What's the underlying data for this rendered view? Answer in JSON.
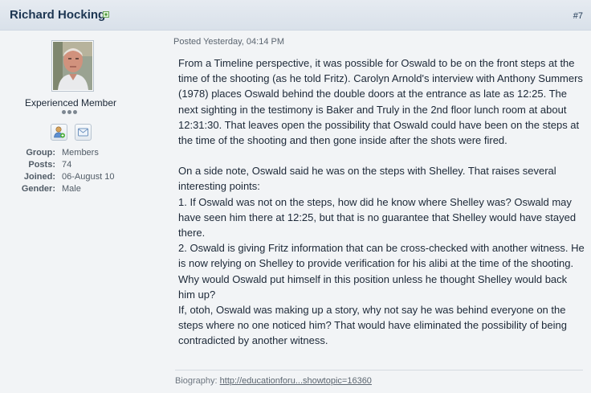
{
  "post": {
    "author": "Richard Hocking",
    "number": "#7",
    "posted": "Posted Yesterday, 04:14 PM"
  },
  "author_info": {
    "rank": "Experienced Member",
    "fields": [
      {
        "label": "Group:",
        "value": "Members"
      },
      {
        "label": "Posts:",
        "value": "74"
      },
      {
        "label": "Joined:",
        "value": "06-August 10"
      },
      {
        "label": "Gender:",
        "value": "Male"
      }
    ],
    "icons": [
      "profile-icon",
      "message-icon"
    ],
    "status_icon": "online-indicator-icon"
  },
  "body": {
    "para1": [
      "From a Timeline perspective, it was possible for Oswald to be on the front steps at the",
      "time of the shooting (as he told Fritz). Carolyn Arnold's interview with Anthony Summers",
      "(1978) places Oswald behind the double doors at the entrance as late as 12:25. The",
      "next sighting in the testimony is Baker and Truly in the 2nd floor lunch room at about",
      "12:31:30. That leaves open the possibility that Oswald could have been on the steps at",
      "the time of the shooting and then gone inside after the shots were fired."
    ],
    "para2": [
      "On a side note, Oswald said he was on the steps with Shelley. That raises several",
      "interesting points:",
      "1. If Oswald was not on the steps, how did he know where Shelley was? Oswald may",
      "have seen him there at 12:25, but that is no guarantee that Shelley would have stayed",
      "there.",
      "2. Oswald is giving Fritz information that can be cross-checked with another witness. He",
      "is now relying on Shelley to provide verification for his alibi at the time of the shooting.",
      "Why would Oswald put himself in this position unless he thought Shelley would back",
      "him up?",
      "If, otoh, Oswald was making up a story, why not say he was behind everyone on the",
      "steps where no one noticed him? That would have eliminated the possibility of being",
      "contradicted by another witness."
    ]
  },
  "signature": {
    "label": "Biography:",
    "link_text": "http://educationforu...showtopic=16360"
  }
}
